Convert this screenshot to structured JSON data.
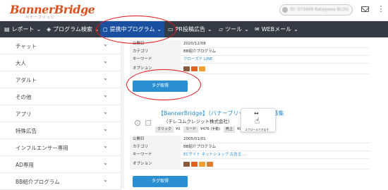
{
  "logo": {
    "text": "BannerBridge",
    "sub": "バナーブリッジ"
  },
  "account": {
    "text": "ID: 073469 Katagawa BLOG"
  },
  "nav": {
    "items": [
      {
        "label": "レポート",
        "icon": "document-icon"
      },
      {
        "label": "プログラム検索",
        "icon": "cube-icon"
      },
      {
        "label": "提携中プログラム",
        "icon": "shield-icon"
      },
      {
        "label": "PR投稿広告",
        "icon": "monitor-icon"
      },
      {
        "label": "ツール",
        "icon": "folder-icon"
      },
      {
        "label": "WEBメール",
        "icon": "email-icon"
      }
    ]
  },
  "sidebar": {
    "items": [
      {
        "label": "チャット"
      },
      {
        "label": "大人"
      },
      {
        "label": "アダルト"
      },
      {
        "label": "その他"
      },
      {
        "label": "アプリ"
      },
      {
        "label": "特殊広告"
      },
      {
        "label": "インフルエンサー専用"
      },
      {
        "label": "AD専用"
      },
      {
        "label": "BB紹介プログラム"
      }
    ]
  },
  "program1": {
    "rows": {
      "opened_key": "公開日",
      "opened_val": "2020/12/08",
      "category_key": "カテゴリ",
      "category_val": "BB紹介プログラム",
      "keyword_key": "キーワード",
      "keyword_val": "クローズド  LINE",
      "option_key": "オプション"
    },
    "tag_button": "タグ取得"
  },
  "program2": {
    "title": "【BannerBridge】（バナーブリッジ）広告主募集",
    "subtitle": "（テレコムクレジット株式会社）",
    "stats": {
      "click_label": "クリック",
      "click_val": "¥0",
      "lead_label": "リード",
      "lead_val": "¥476 (手動)",
      "sale_label": "売上",
      "sale_val": "¥9,523 (手動)"
    },
    "rows": {
      "opened_key": "公開日",
      "opened_val": "2005/01/01",
      "category_key": "カテゴリ",
      "category_val": "BB紹介プログラム",
      "keyword_key": "キーワード",
      "keyword_val": "ECサイト  ネットショップ  広告主 ...",
      "option_key": "オプション"
    },
    "tag_button": "タグ取得"
  },
  "tooltip": {
    "text": "スクロールできます"
  },
  "colors": {
    "nav_bg": "#353b45",
    "active_nav": "#1b4fa0",
    "accent": "#2a8fd0",
    "logo": "#d9501e",
    "annotation": "#e0161b"
  }
}
